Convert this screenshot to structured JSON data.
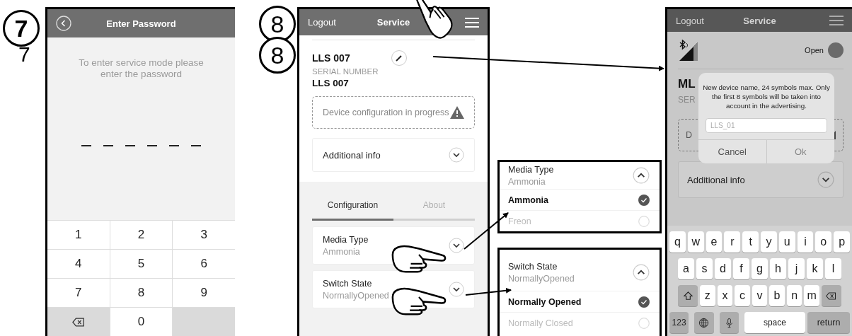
{
  "step_badges": [
    {
      "number": "7",
      "note": "7"
    },
    {
      "number": "8"
    },
    {
      "number": "8"
    }
  ],
  "password_screen": {
    "title": "Enter Password",
    "message": "To enter service mode please enter the password",
    "pin_slots": [
      {
        "filled": false
      },
      {
        "filled": false
      },
      {
        "filled": false
      },
      {
        "filled": false
      },
      {
        "filled": false
      },
      {
        "filled": false
      }
    ],
    "keypad": [
      {
        "kind": "digit",
        "label": "1"
      },
      {
        "kind": "digit",
        "label": "2"
      },
      {
        "kind": "digit",
        "label": "3"
      },
      {
        "kind": "digit",
        "label": "4"
      },
      {
        "kind": "digit",
        "label": "5"
      },
      {
        "kind": "digit",
        "label": "6"
      },
      {
        "kind": "digit",
        "label": "7"
      },
      {
        "kind": "digit",
        "label": "8"
      },
      {
        "kind": "digit",
        "label": "9"
      },
      {
        "kind": "backspace"
      },
      {
        "kind": "digit",
        "label": "0"
      },
      {
        "kind": "blank"
      }
    ]
  },
  "service_screen": {
    "header": {
      "left": "Logout",
      "title": "Service"
    },
    "device_name": "LLS 007",
    "serial_label": "SERIAL NUMBER",
    "serial_value": "LLS 007",
    "status_message": "Device configuration in progress",
    "additional_info": {
      "label": "Additional info",
      "expanded": false
    },
    "tabs": [
      {
        "label": "Configuration",
        "selected": true
      },
      {
        "label": "About",
        "selected": false
      }
    ],
    "settings": [
      {
        "label": "Media Type",
        "value": "Ammonia",
        "expanded": false
      },
      {
        "label": "Switch State",
        "value": "NormallyOpened",
        "expanded": false
      }
    ]
  },
  "expanded_settings": [
    {
      "label": "Media Type",
      "value": "Ammonia",
      "expanded": true,
      "options": [
        {
          "label": "Ammonia",
          "selected": true
        },
        {
          "label": "Freon",
          "selected": false
        }
      ]
    },
    {
      "label": "Switch State",
      "value": "NormallyOpened",
      "expanded": true,
      "options": [
        {
          "label": "Normally Opened",
          "selected": true
        },
        {
          "label": "Normally Closed",
          "selected": false
        }
      ]
    }
  ],
  "rename_screen": {
    "header": {
      "left": "Logout",
      "title": "Service"
    },
    "connection_status": "Open",
    "device_name": "ML",
    "serial_label": "SER",
    "status_message": "D",
    "additional_info": {
      "label": "Additional info",
      "expanded": false
    },
    "dialog": {
      "message": "New device name, 24 symbols max. Only the first 8 symbols will be taken into account in the advertising.",
      "placeholder": "LLS_01",
      "buttons": [
        "Cancel",
        "Ok"
      ]
    },
    "keyboard": [
      [
        {
          "kind": "char",
          "label": "q"
        },
        {
          "kind": "char",
          "label": "w"
        },
        {
          "kind": "char",
          "label": "e"
        },
        {
          "kind": "char",
          "label": "r"
        },
        {
          "kind": "char",
          "label": "t"
        },
        {
          "kind": "char",
          "label": "y"
        },
        {
          "kind": "char",
          "label": "u"
        },
        {
          "kind": "char",
          "label": "i"
        },
        {
          "kind": "char",
          "label": "o"
        },
        {
          "kind": "char",
          "label": "p"
        }
      ],
      [
        {
          "kind": "char",
          "label": "a"
        },
        {
          "kind": "char",
          "label": "s"
        },
        {
          "kind": "char",
          "label": "d"
        },
        {
          "kind": "char",
          "label": "f"
        },
        {
          "kind": "char",
          "label": "g"
        },
        {
          "kind": "char",
          "label": "h"
        },
        {
          "kind": "char",
          "label": "j"
        },
        {
          "kind": "char",
          "label": "k"
        },
        {
          "kind": "char",
          "label": "l"
        }
      ],
      [
        {
          "kind": "shift"
        },
        {
          "kind": "char",
          "label": "z"
        },
        {
          "kind": "char",
          "label": "x"
        },
        {
          "kind": "char",
          "label": "c"
        },
        {
          "kind": "char",
          "label": "v"
        },
        {
          "kind": "char",
          "label": "b"
        },
        {
          "kind": "char",
          "label": "n"
        },
        {
          "kind": "char",
          "label": "m"
        },
        {
          "kind": "backspace"
        }
      ],
      [
        {
          "kind": "mode",
          "label": "123"
        },
        {
          "kind": "globe"
        },
        {
          "kind": "mic"
        },
        {
          "kind": "space",
          "label": "space"
        },
        {
          "kind": "return",
          "label": "return"
        }
      ]
    ]
  }
}
